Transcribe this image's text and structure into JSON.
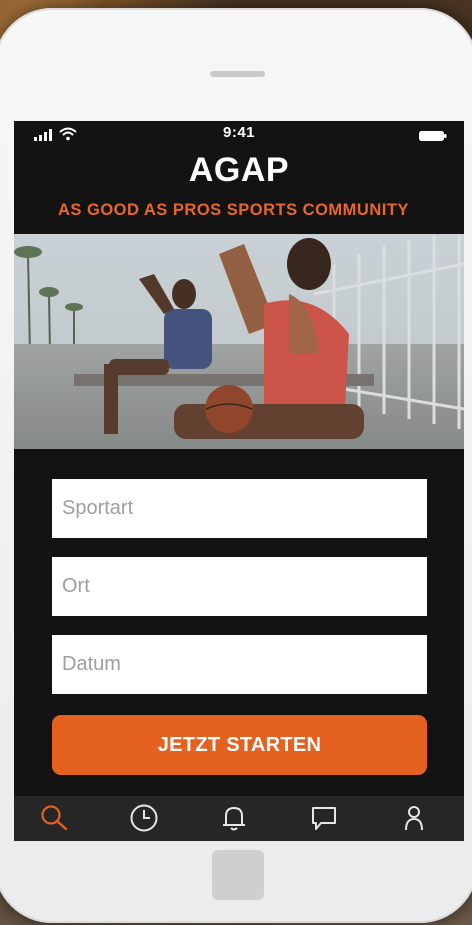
{
  "status_bar": {
    "time": "9:41"
  },
  "app": {
    "title": "AGAP",
    "subtitle": "AS GOOD AS PROS SPORTS COMMUNITY"
  },
  "hero": {
    "icon": "photo-two-athletes-drinking"
  },
  "form": {
    "sport_placeholder": "Sportart",
    "location_placeholder": "Ort",
    "date_placeholder": "Datum",
    "submit_label": "JETZT STARTEN"
  },
  "tabs": [
    {
      "icon": "search-icon",
      "active": true
    },
    {
      "icon": "clock-icon",
      "active": false
    },
    {
      "icon": "bell-icon",
      "active": false
    },
    {
      "icon": "chat-icon",
      "active": false
    },
    {
      "icon": "profile-icon",
      "active": false
    }
  ],
  "colors": {
    "accent": "#e4611f",
    "screen_bg": "#141313",
    "tab_bar_bg": "#262626",
    "tab_icon": "#e6e6e6"
  }
}
